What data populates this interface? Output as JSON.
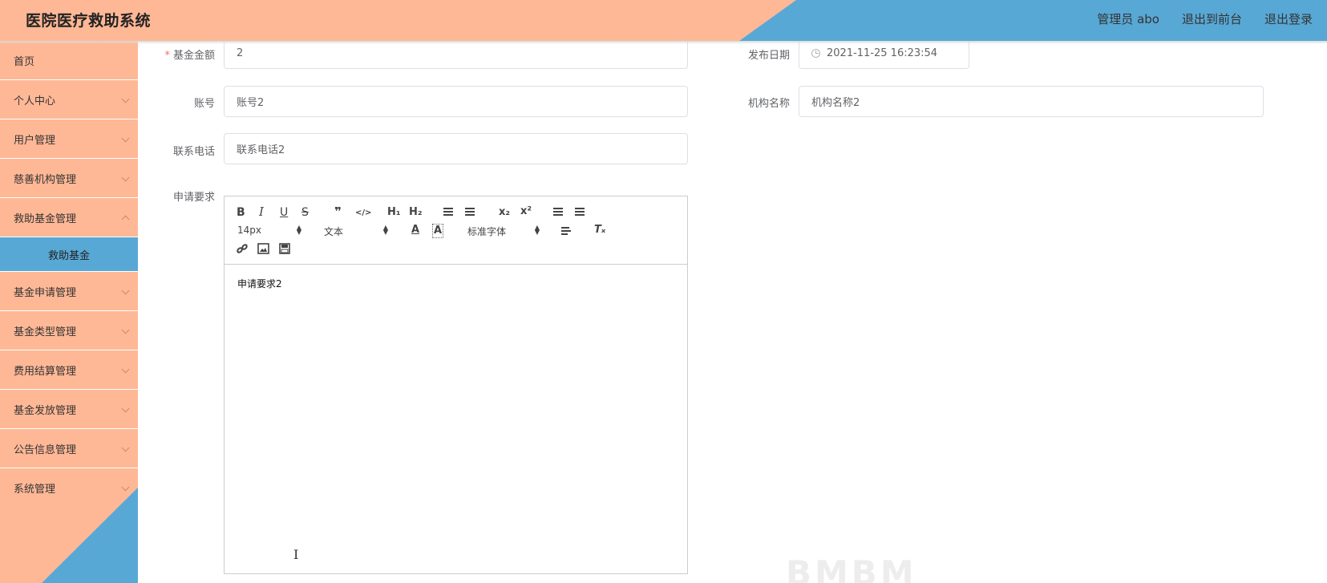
{
  "header": {
    "title": "医院医疗救助系统",
    "admin": "管理员 abo",
    "to_front": "退出到前台",
    "logout": "退出登录"
  },
  "colors": {
    "peach": "#ffb896",
    "blue": "#58a8d5"
  },
  "sidebar": {
    "items": [
      {
        "label": "首页"
      },
      {
        "label": "个人中心"
      },
      {
        "label": "用户管理"
      },
      {
        "label": "慈善机构管理"
      },
      {
        "label": "救助基金管理"
      },
      {
        "label": "救助基金"
      },
      {
        "label": "基金申请管理"
      },
      {
        "label": "基金类型管理"
      },
      {
        "label": "费用结算管理"
      },
      {
        "label": "基金发放管理"
      },
      {
        "label": "公告信息管理"
      },
      {
        "label": "系统管理"
      }
    ]
  },
  "form": {
    "fund_amount": {
      "label": "基金金额",
      "required_mark": "*",
      "value": "2"
    },
    "publish_date": {
      "label": "发布日期",
      "value": "2021-11-25 16:23:54"
    },
    "account": {
      "label": "账号",
      "value": "账号2"
    },
    "org_name": {
      "label": "机构名称",
      "value": "机构名称2"
    },
    "phone": {
      "label": "联系电话",
      "value": "联系电话2"
    },
    "requirements": {
      "label": "申请要求",
      "content": "申请要求2"
    }
  },
  "editor_toolbar": {
    "font_size": "14px",
    "header": "文本",
    "font_family": "标准字体",
    "bold": "B",
    "italic": "I",
    "underline": "U",
    "strike": "S",
    "quote": "❞",
    "code": "</>",
    "h1": "H₁",
    "h2": "H₂",
    "sub": "x₂",
    "sup": "x²",
    "color": "A",
    "background": "A",
    "clean": "Tₓ"
  },
  "watermark": "BMBM"
}
